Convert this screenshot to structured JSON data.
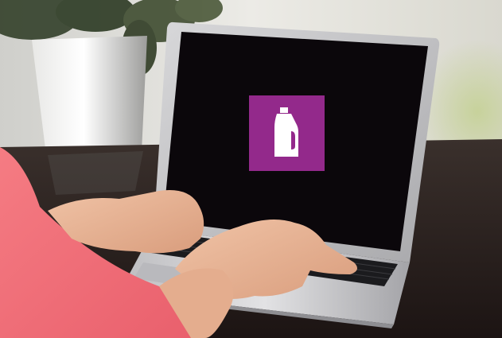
{
  "scene": {
    "description_free": true
  },
  "screen": {
    "icon": "detergent-bottle-icon",
    "tile_color": "#93298b",
    "screen_color": "#0b070b"
  },
  "colors": {
    "background_wall": "#e7e6e1",
    "table": "#2a1e1c",
    "laptop_silver": "#c9c9cb",
    "sleeve": "#f2707a",
    "skin": "#e9b79a"
  }
}
